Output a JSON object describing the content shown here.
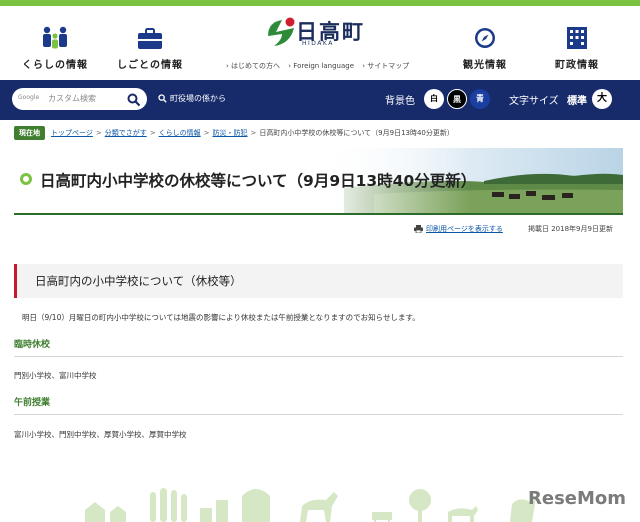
{
  "header": {
    "nav_left": [
      {
        "label": "くらしの情報",
        "icon": "people-icon"
      },
      {
        "label": "しごとの情報",
        "icon": "briefcase-icon"
      }
    ],
    "nav_right": [
      {
        "label": "観光情報",
        "icon": "compass-icon"
      },
      {
        "label": "町政情報",
        "icon": "building-icon"
      }
    ],
    "logo_name": "日高町",
    "logo_sub": "HIDAKA",
    "sublinks": [
      "› はじめての方へ",
      "› Foreign language",
      "› サイトマップ"
    ]
  },
  "toolbar": {
    "search_brand": "Google",
    "search_placeholder": "カスタム検索",
    "dept_link": "町役場の係から",
    "bg_label": "背景色",
    "bg_options": [
      "白",
      "黒",
      "青"
    ],
    "font_label": "文字サイズ",
    "font_value": "標準",
    "font_button": "大"
  },
  "breadcrumb": {
    "here": "現在地",
    "links": [
      "トップページ",
      "分類でさがす",
      "くらしの情報",
      "防災・防犯"
    ],
    "current": "日高町内小中学校の休校等について（9月9日13時40分更新）"
  },
  "page": {
    "title": "日高町内小中学校の休校等について（9月9日13時40分更新）",
    "print_link": "印刷用ページを表示する",
    "posted": "掲載日 2018年9月9日更新",
    "section_heading": "日高町内の小中学校について（休校等）",
    "intro": "明日（9/10）月曜日の町内小中学校については地震の影響により休校または午前授業となりますのでお知らせします。",
    "closure_heading": "臨時休校",
    "closure_schools": "門別小学校、富川中学校",
    "morning_heading": "午前授業",
    "morning_schools": "富川小学校、門別中学校、厚賀小学校、厚賀中学校"
  },
  "watermark": "ReseMom",
  "colors": {
    "accent_green": "#7cc242",
    "dark_green": "#3f7f2f",
    "navy": "#172b6b",
    "heading_red": "#c8182d",
    "link_blue": "#0b57a5"
  }
}
